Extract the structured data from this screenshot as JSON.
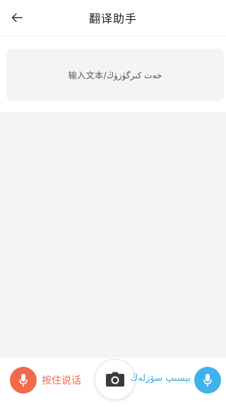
{
  "header": {
    "title": "翻译助手",
    "back_icon": "arrow-left-icon"
  },
  "input": {
    "placeholder": "输入文本/خەت كىرگۈزۈڭ"
  },
  "bottom_bar": {
    "left_voice_label": "按住说话",
    "right_voice_label": "بېسىپ سۆزلەڭ",
    "left_mic_icon": "microphone-icon",
    "camera_icon": "camera-icon",
    "right_mic_icon": "microphone-icon",
    "left_color": "#ef6a4a",
    "right_color": "#3fb2ee"
  }
}
